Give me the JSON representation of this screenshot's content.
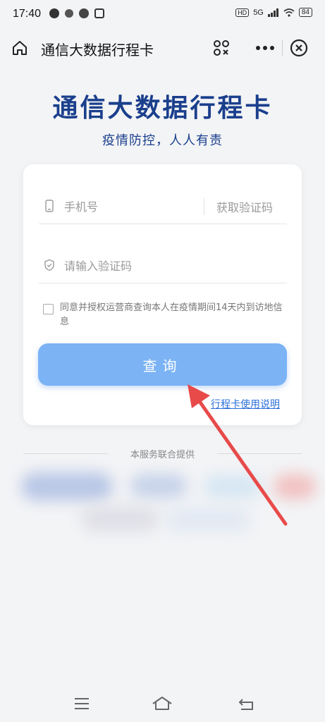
{
  "status_bar": {
    "time": "17:40",
    "hd": "HD",
    "network": "5G",
    "battery": "84"
  },
  "nav": {
    "title": "通信大数据行程卡",
    "icons": [
      "home-icon",
      "scan-icon",
      "more-icon",
      "close-icon"
    ]
  },
  "hero": {
    "title": "通信大数据行程卡",
    "subtitle": "疫情防控，人人有责"
  },
  "form": {
    "phone_placeholder": "手机号",
    "get_code_label": "获取验证码",
    "code_placeholder": "请输入验证码",
    "agree_text": "同意并授权运营商查询本人在疫情期间14天内到访地信息",
    "agree_checked": false,
    "query_button": "查询",
    "help_link": "行程卡使用说明"
  },
  "provider": {
    "label": "本服务联合提供"
  },
  "colors": {
    "brand": "#1a3f8c",
    "button": "#7bb3f5",
    "link": "#2b6fd8",
    "arrow": "#e84a4a"
  }
}
